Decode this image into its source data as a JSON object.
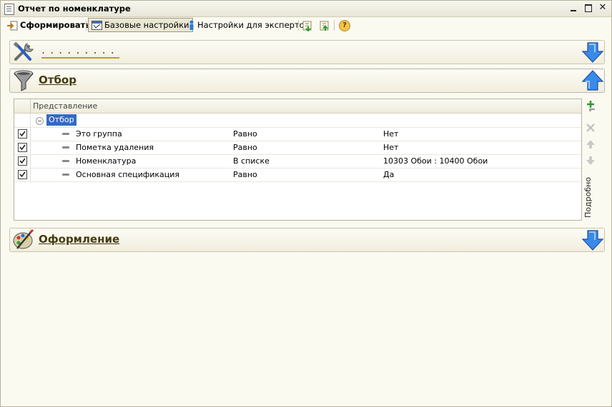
{
  "window": {
    "title": "Отчет по номенклатуре"
  },
  "toolbar": {
    "form_label": "Сформировать",
    "base_label": "Базовые настройки",
    "expert_label": "Настройки для экспертов",
    "help_label": "?"
  },
  "sections": {
    "settings": {
      "label": ".........",
      "icon": "tools-icon",
      "expanded": false
    },
    "filter": {
      "label": "Отбор",
      "icon": "funnel-icon",
      "expanded": true
    },
    "design": {
      "label": "Оформление",
      "icon": "palette-icon",
      "expanded": false
    }
  },
  "filter_grid": {
    "header": "Представление",
    "group": "Отбор",
    "rows": [
      {
        "checked": true,
        "field": "Это группа",
        "condition": "Равно",
        "value": "Нет"
      },
      {
        "checked": true,
        "field": "Пометка удаления",
        "condition": "Равно",
        "value": "Нет"
      },
      {
        "checked": true,
        "field": "Номенклатура",
        "condition": "В списке",
        "value": "10303 Обои : 10400 Обои"
      },
      {
        "checked": true,
        "field": "Основная спецификация",
        "condition": "Равно",
        "value": "Да"
      }
    ]
  },
  "side_panel": {
    "details_label": "Подробно"
  },
  "colors": {
    "background": "#fbfaf1",
    "accent_blue": "#2b78d8",
    "selection": "#316ac5",
    "link": "#433b12"
  }
}
